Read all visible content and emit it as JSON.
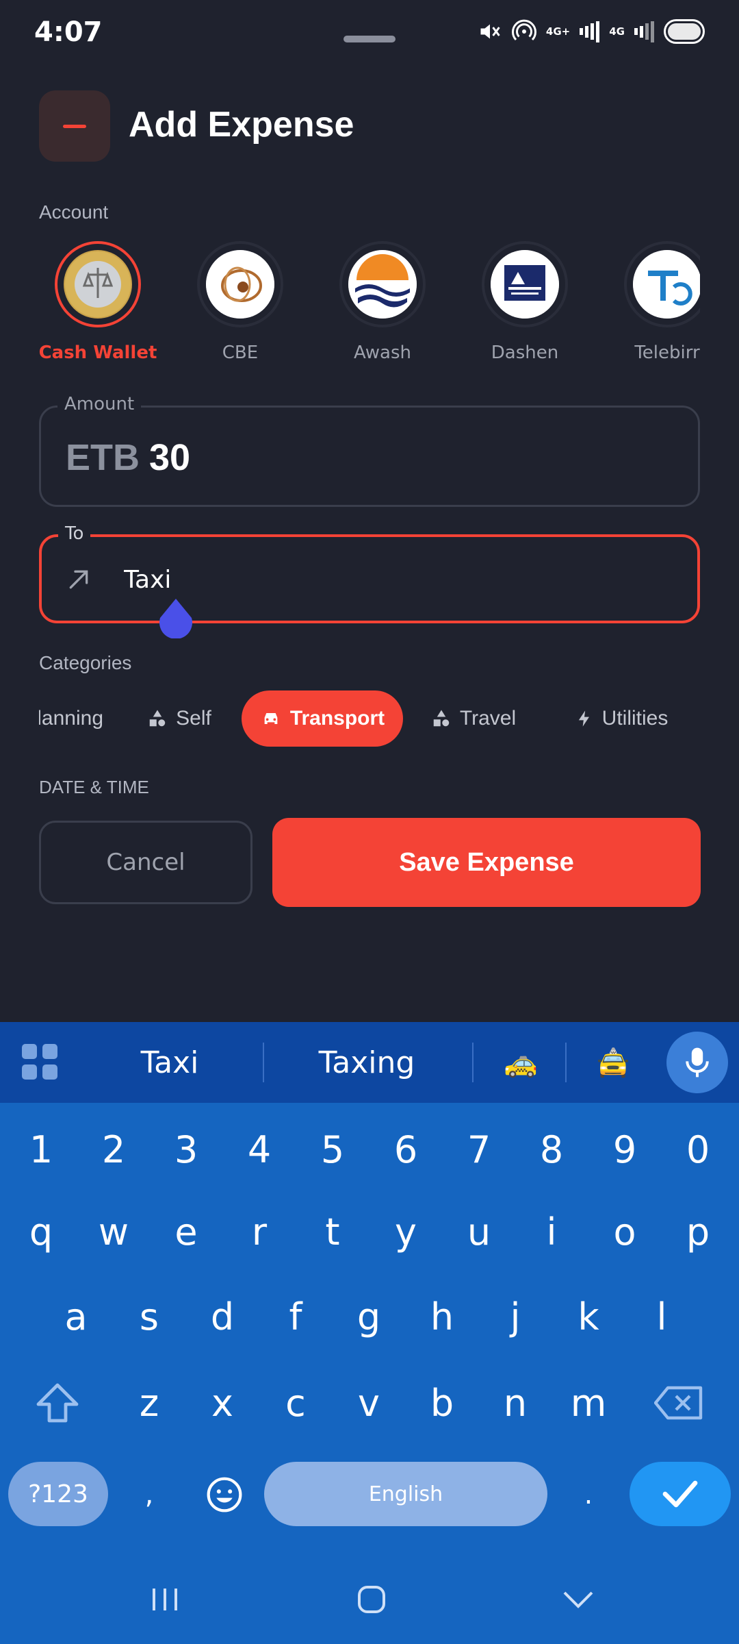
{
  "status_bar": {
    "time": "4:07",
    "net1": "4G+",
    "net2": "4G"
  },
  "header": {
    "title": "Add Expense"
  },
  "account_section": {
    "label": "Account",
    "accounts": [
      {
        "name": "Cash Wallet",
        "selected": true
      },
      {
        "name": "CBE",
        "selected": false
      },
      {
        "name": "Awash",
        "selected": false
      },
      {
        "name": "Dashen",
        "selected": false
      },
      {
        "name": "Telebirr",
        "selected": false
      }
    ]
  },
  "amount": {
    "label": "Amount",
    "currency": "ETB",
    "value": "30"
  },
  "to": {
    "label": "To",
    "value": "Taxi"
  },
  "categories": {
    "label": "Categories",
    "items": [
      {
        "label": "Planning",
        "icon": "none"
      },
      {
        "label": "Self",
        "icon": "shapes-icon"
      },
      {
        "label": "Transport",
        "icon": "car-icon",
        "active": true
      },
      {
        "label": "Travel",
        "icon": "shapes-icon"
      },
      {
        "label": "Utilities",
        "icon": "bolt-icon"
      }
    ]
  },
  "datetime": {
    "label": "DATE & TIME"
  },
  "actions": {
    "cancel": "Cancel",
    "save": "Save Expense"
  },
  "keyboard": {
    "suggestions": [
      "Taxi",
      "Taxing",
      "🚕",
      "🚖"
    ],
    "row_numbers": [
      "1",
      "2",
      "3",
      "4",
      "5",
      "6",
      "7",
      "8",
      "9",
      "0"
    ],
    "row_q": [
      "q",
      "w",
      "e",
      "r",
      "t",
      "y",
      "u",
      "i",
      "o",
      "p"
    ],
    "row_a": [
      "a",
      "s",
      "d",
      "f",
      "g",
      "h",
      "j",
      "k",
      "l"
    ],
    "row_z": [
      "z",
      "x",
      "c",
      "v",
      "b",
      "n",
      "m"
    ],
    "symbols": "?123",
    "comma": ",",
    "space": "English",
    "period": "."
  },
  "colors": {
    "accent": "#f44336",
    "background": "#1f222e",
    "keyboard": "#1565c0"
  }
}
